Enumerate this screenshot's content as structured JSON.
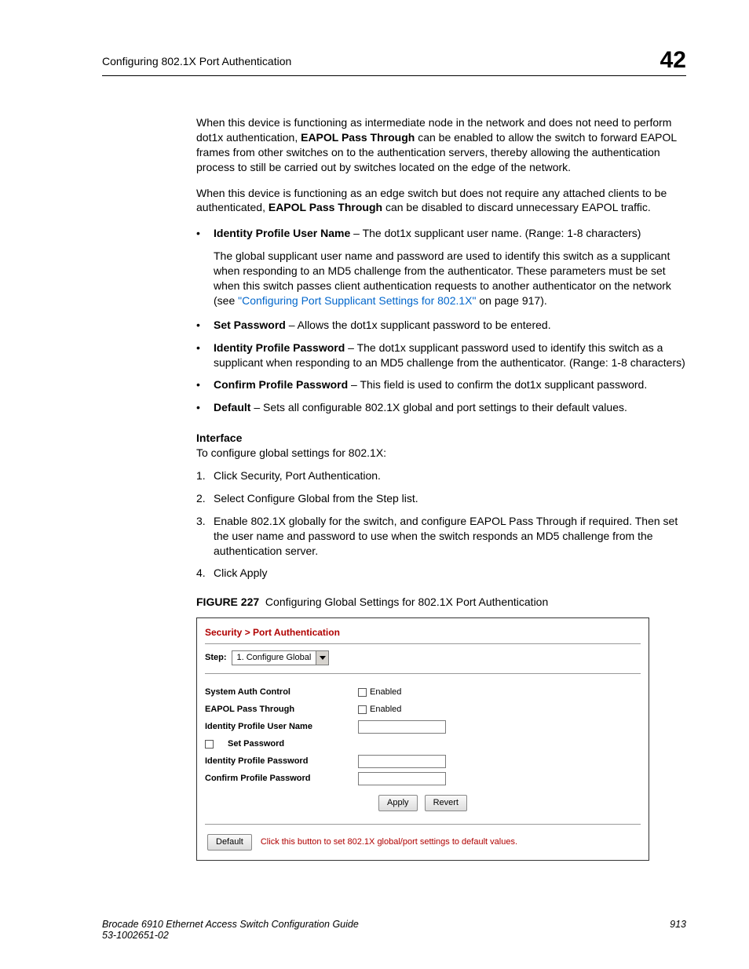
{
  "header": {
    "left": "Configuring 802.1X Port Authentication",
    "right": "42"
  },
  "p1_a": "When this device is functioning as intermediate node in the network and does not need to perform dot1x authentication, ",
  "p1_b": "EAPOL Pass Through",
  "p1_c": " can be enabled to allow the switch to forward EAPOL frames from other switches on to the authentication servers, thereby allowing the authentication process to still be carried out by switches located on the edge of the network.",
  "p2_a": "When this device is functioning as an edge switch but does not require any attached clients to be authenticated, ",
  "p2_b": "EAPOL Pass Through",
  "p2_c": " can be disabled to discard unnecessary EAPOL traffic.",
  "bul_identity_name_t": "Identity Profile User Name",
  "bul_identity_name_b": " – The dot1x supplicant user name. (Range: 1-8 characters)",
  "sub1_a": "The global supplicant user name and password are used to identify this switch as a supplicant when responding to an MD5 challenge from the authenticator. These parameters must be set when this switch passes client authentication requests to another authenticator on the network (see ",
  "sub1_link": "\"Configuring Port Supplicant Settings for 802.1X\"",
  "sub1_b": " on page 917).",
  "bul_setpw_t": "Set Password",
  "bul_setpw_b": " – Allows the dot1x supplicant password to be entered.",
  "bul_idpw_t": "Identity Profile Password",
  "bul_idpw_b": " – The dot1x supplicant password used to identify this switch as a supplicant when responding to an MD5 challenge from the authenticator. (Range: 1-8 characters)",
  "bul_confirm_t": "Confirm Profile Password",
  "bul_confirm_b": " – This field is used to confirm the dot1x supplicant password.",
  "bul_default_t": "Default",
  "bul_default_b": " – Sets all configurable 802.1X global and port settings to their default values.",
  "interface_head": "Interface",
  "interface_intro": "To configure global settings for 802.1X:",
  "steps": [
    "Click Security, Port Authentication.",
    "Select Configure Global from the Step list.",
    "Enable 802.1X globally for the switch, and configure EAPOL Pass Through if required. Then set the user name and password to use when the switch responds an MD5 challenge from the authentication server.",
    "Click Apply"
  ],
  "figure_label": "FIGURE 227",
  "figure_caption": "Configuring Global Settings for 802.1X Port Authentication",
  "fig": {
    "breadcrumb": "Security > Port Authentication",
    "step_label": "Step:",
    "step_value": "1. Configure Global",
    "row_sysauth": "System Auth Control",
    "row_eapol": "EAPOL Pass Through",
    "row_identity_user": "Identity Profile User Name",
    "row_setpw": "Set Password",
    "row_identity_pw": "Identity Profile Password",
    "row_confirm_pw": "Confirm Profile Password",
    "enabled_label": "Enabled",
    "apply": "Apply",
    "revert": "Revert",
    "default_btn": "Default",
    "default_note": "Click this button to set 802.1X global/port settings to default values."
  },
  "footer": {
    "left1": "Brocade 6910 Ethernet Access Switch Configuration Guide",
    "left2": "53-1002651-02",
    "right": "913"
  }
}
